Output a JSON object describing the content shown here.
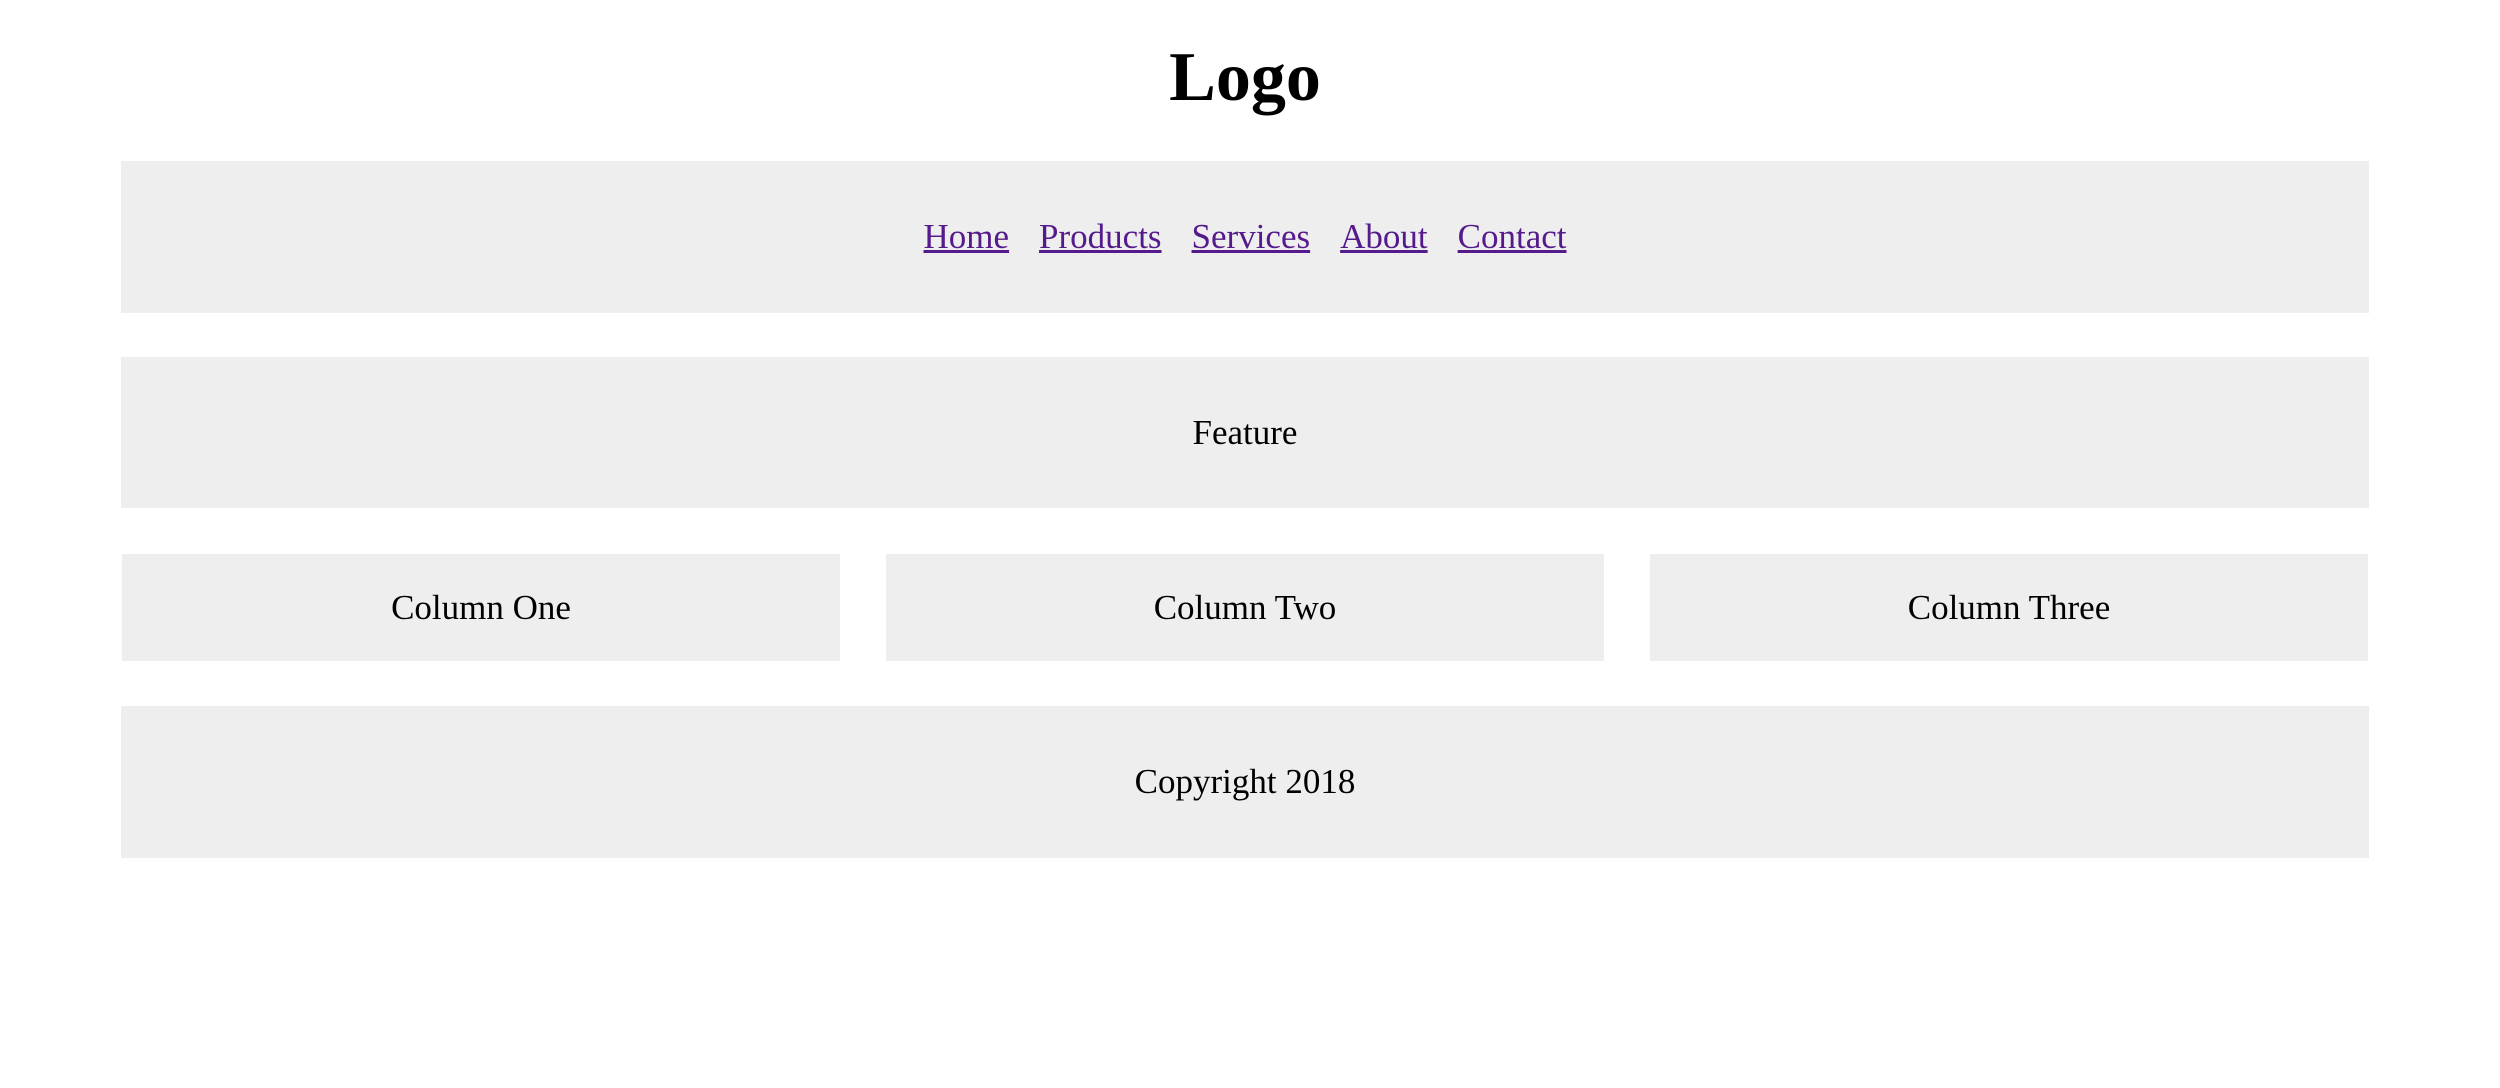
{
  "header": {
    "logo": "Logo"
  },
  "nav": {
    "links": [
      {
        "label": "Home"
      },
      {
        "label": "Products"
      },
      {
        "label": "Services"
      },
      {
        "label": "About"
      },
      {
        "label": "Contact"
      }
    ],
    "link_color": "#551a8b"
  },
  "feature": {
    "text": "Feature"
  },
  "columns": [
    {
      "text": "Column One"
    },
    {
      "text": "Column Two"
    },
    {
      "text": "Column Three"
    }
  ],
  "footer": {
    "text": "Copyright 2018"
  },
  "colors": {
    "panel_background": "#eeeeee",
    "page_background": "#ffffff",
    "text": "#000000"
  }
}
